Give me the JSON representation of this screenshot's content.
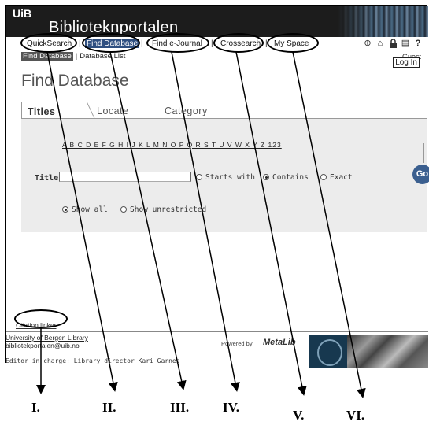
{
  "banner": {
    "logo": "UiB",
    "portal_title": "Biblioteknportalen"
  },
  "nav": {
    "items": [
      {
        "label": "QuickSearch",
        "active": false
      },
      {
        "label": "Find Database",
        "active": true
      },
      {
        "label": "Find e-Journal",
        "active": false
      },
      {
        "label": "Crossearch",
        "active": false
      },
      {
        "label": "My Space",
        "active": false
      }
    ],
    "tools": [
      "globe-icon",
      "library-icon",
      "lock-icon",
      "document-icon",
      "help-icon"
    ],
    "tool_glyphs": [
      "⊕",
      "⌂",
      "🔒",
      "▤",
      "?"
    ]
  },
  "subnav": {
    "active": "Find Database",
    "other": "Database List"
  },
  "user": {
    "status": "Guest",
    "login": "Log In"
  },
  "page": {
    "title": "Find Database"
  },
  "tabs": [
    "Titles",
    "Locate",
    "Category"
  ],
  "search": {
    "alphabet": "A B C D E F G H I J K L M N O P Q R S T U V W X Y Z 123",
    "title_label": "Title:",
    "title_value": "",
    "options": [
      {
        "label": "Starts with",
        "selected": false
      },
      {
        "label": "Contains",
        "selected": true
      },
      {
        "label": "Exact",
        "selected": false
      }
    ],
    "filters": [
      {
        "label": "Show all",
        "selected": true
      },
      {
        "label": "Show unrestricted",
        "selected": false
      }
    ],
    "go_label": "Go"
  },
  "links": {
    "citation": "Citation linker"
  },
  "footer": {
    "org": "University of Bergen Library",
    "email": "bibliotekportalen@uib.no",
    "editor": "Editor in charge: Library director Kari Garnes",
    "powered_by": "Powered by",
    "product": "MetaLib"
  },
  "annotations": [
    "I.",
    "II.",
    "III.",
    "IV.",
    "V.",
    "VI."
  ]
}
